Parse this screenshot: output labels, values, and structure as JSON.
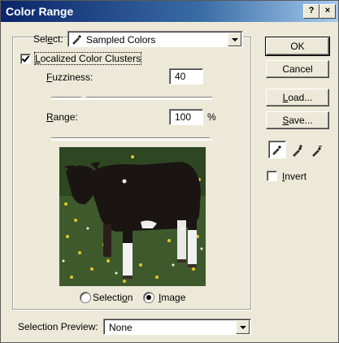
{
  "window": {
    "title": "Color Range",
    "help_label": "?",
    "close_label": "×"
  },
  "select": {
    "label_pre": "Sel",
    "label_accel": "e",
    "label_post": "ct:",
    "value": "Sampled Colors",
    "icon": "eyedropper-icon"
  },
  "localized": {
    "label_pre": "",
    "label_accel": "L",
    "label_post": "ocalized Color Clusters",
    "checked": true
  },
  "fuzziness": {
    "label_pre": "",
    "label_accel": "F",
    "label_post": "uzziness:",
    "value": "40",
    "slider_fraction": 0.2
  },
  "range": {
    "label_pre": "",
    "label_accel": "R",
    "label_post": "ange:",
    "value": "100",
    "unit": "%",
    "slider_fraction": 1.0
  },
  "preview_mode": {
    "selection": {
      "label_pre": "Selecti",
      "label_accel": "o",
      "label_post": "n",
      "selected": false
    },
    "image": {
      "label_pre": "",
      "label_accel": "I",
      "label_post": "mage",
      "selected": true
    }
  },
  "buttons": {
    "ok": "OK",
    "cancel": "Cancel",
    "load": {
      "label_pre": "",
      "label_accel": "L",
      "label_post": "oad..."
    },
    "save": {
      "label_pre": "",
      "label_accel": "S",
      "label_post": "ave..."
    }
  },
  "tools": [
    {
      "icon": "eyedropper-icon",
      "active": true
    },
    {
      "icon": "eyedropper-plus-icon",
      "active": false
    },
    {
      "icon": "eyedropper-minus-icon",
      "active": false
    }
  ],
  "invert": {
    "label_pre": "",
    "label_accel": "I",
    "label_post": "nvert",
    "checked": false
  },
  "selection_preview": {
    "label": "Selection Preview:",
    "value": "None"
  },
  "colors": {
    "title_start": "#0a246a",
    "title_end": "#a6caf0",
    "face": "#ece9d8"
  }
}
